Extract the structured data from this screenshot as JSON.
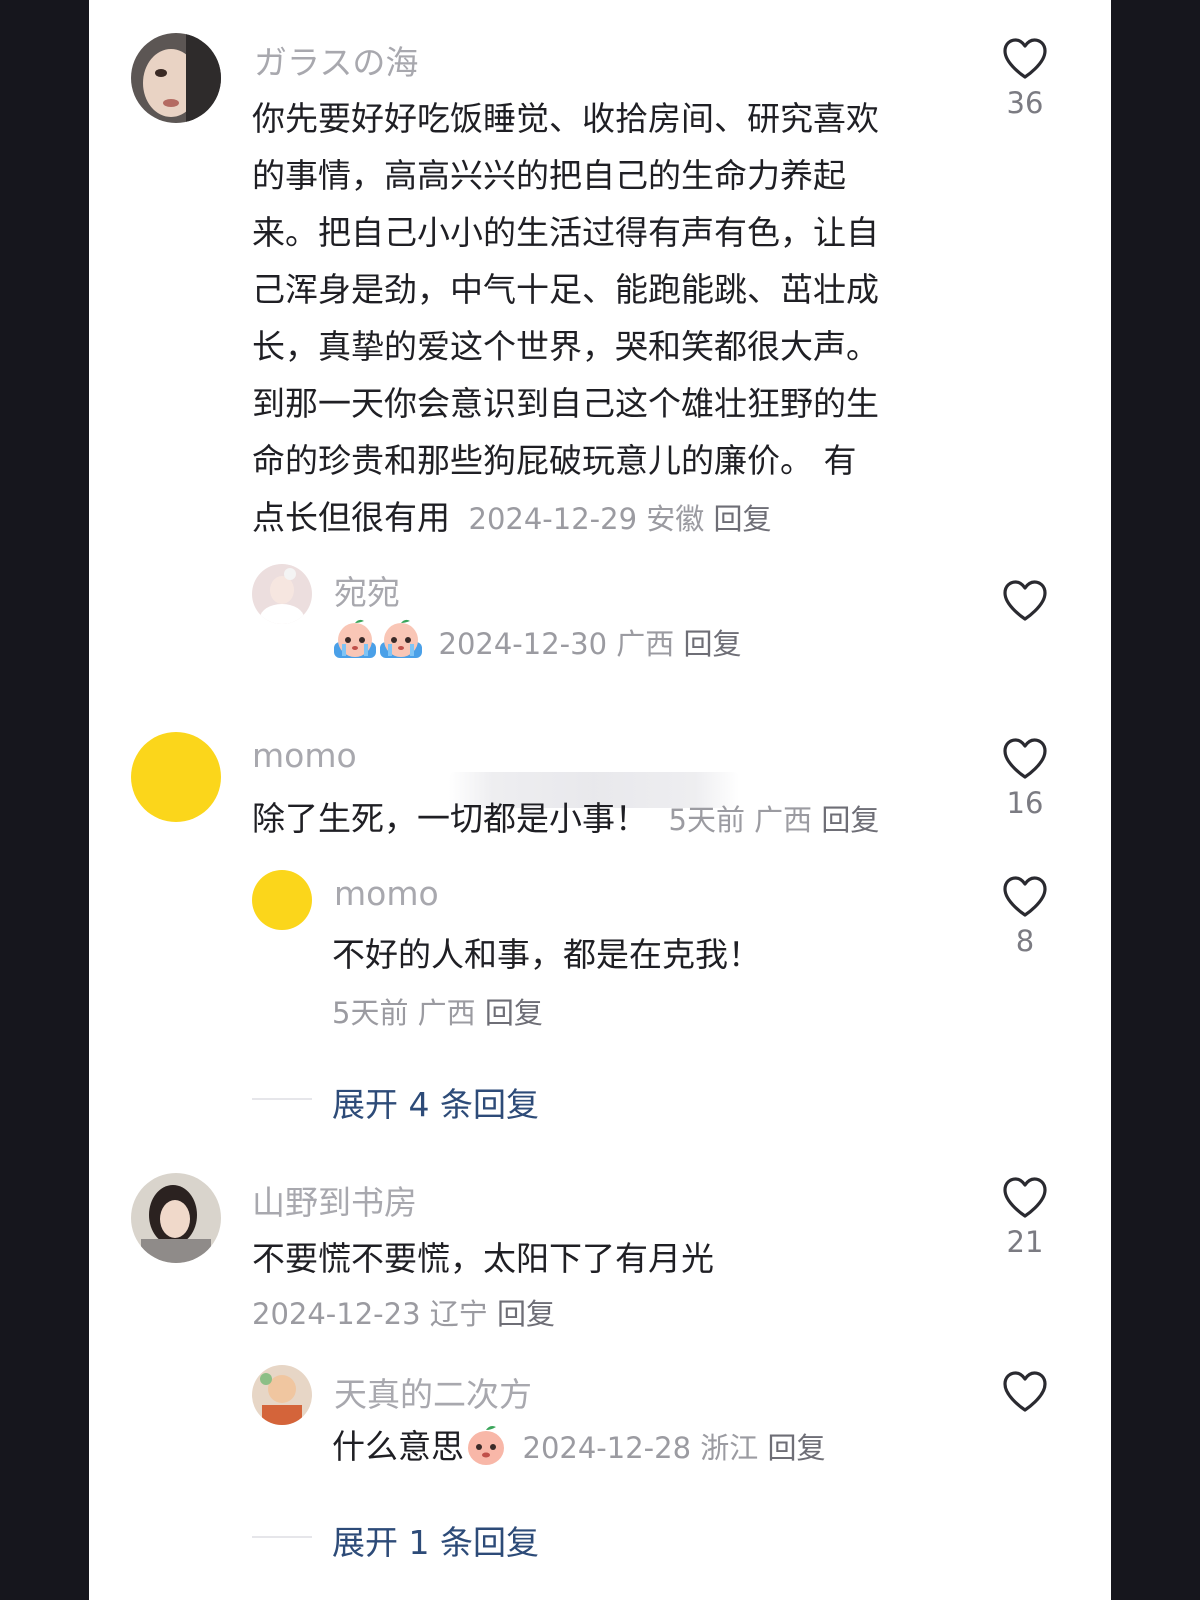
{
  "comments": [
    {
      "username": "ガラスの海",
      "lines": [
        "你先要好好吃饭睡觉、收拾房间、研究喜欢",
        "的事情，高高兴兴的把自己的生命力养起",
        "来。把自己小小的生活过得有声有色，让自",
        "己浑身是劲，中气十足、能跑能跳、茁壮成",
        "长，真挚的爱这个世界，哭和笑都很大声。",
        "到那一天你会意识到自己这个雄壮狂野的生",
        "命的珍贵和那些狗屁破玩意儿的廉价。 有",
        "点长但很有用"
      ],
      "date": "2024-12-29",
      "location": "安徽",
      "reply_label": "回复",
      "likes": "36"
    },
    {
      "username": "宛宛",
      "date": "2024-12-30",
      "location": "广西",
      "reply_label": "回复"
    },
    {
      "username": "momo",
      "text": "除了生死，一切都是小事！",
      "date": "5天前",
      "location": "广西",
      "reply_label": "回复",
      "likes": "16"
    },
    {
      "username": "momo",
      "text": "不好的人和事，都是在克我！",
      "date": "5天前",
      "location": "广西",
      "reply_label": "回复",
      "likes": "8"
    },
    {
      "username": "山野到书房",
      "text": "不要慌不要慌，太阳下了有月光",
      "date": "2024-12-23",
      "location": "辽宁",
      "reply_label": "回复",
      "likes": "21"
    },
    {
      "username": "天真的二次方",
      "text": "什么意思",
      "date": "2024-12-28",
      "location": "浙江",
      "reply_label": "回复"
    }
  ],
  "expand_1": "展开 4 条回复",
  "expand_2": "展开 1 条回复",
  "icons": {
    "like": "heart-outline-icon",
    "emoji": "crying-peach-emoji"
  },
  "colors": {
    "background": "#16161d",
    "link": "#2d4b78",
    "avatar_yellow": "#fbd61b"
  }
}
